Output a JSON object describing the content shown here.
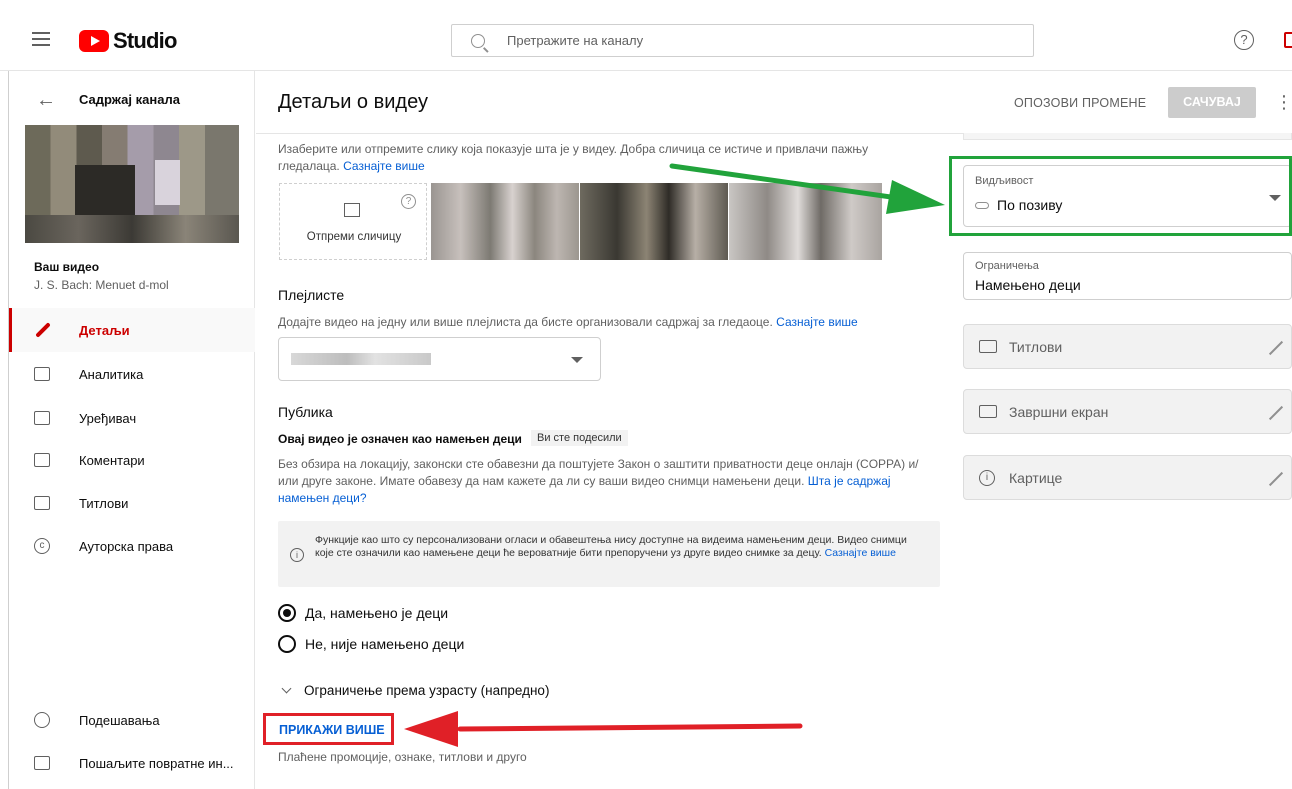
{
  "topbar": {
    "logo_text": "Studio",
    "search_placeholder": "Претражите на каналу"
  },
  "sidebar": {
    "title": "Садржај канала",
    "your_video_label": "Ваш видео",
    "video_title": "J. S. Bach: Menuet d-mol",
    "items": [
      {
        "label": "Детаљи",
        "icon": "pencil-icon",
        "active": true
      },
      {
        "label": "Аналитика",
        "icon": "analytics-icon"
      },
      {
        "label": "Уређивач",
        "icon": "editor-icon"
      },
      {
        "label": "Коментари",
        "icon": "comments-icon"
      },
      {
        "label": "Титлови",
        "icon": "subtitles-icon"
      },
      {
        "label": "Ауторска права",
        "icon": "copyright-icon"
      }
    ],
    "bottom_items": [
      {
        "label": "Подешавања",
        "icon": "gear-icon"
      },
      {
        "label": "Пошаљите повратне ин...",
        "icon": "feedback-icon"
      }
    ]
  },
  "header": {
    "title": "Детаљи о видеу",
    "undo_label": "ОПОЗОВИ ПРОМЕНЕ",
    "save_label": "САЧУВАЈ"
  },
  "thumbnail": {
    "description": "Изаберите или отпремите слику која показује шта је у видеу. Добра сличица се истиче и привлачи пажњу гледалаца.",
    "learn_more": "Сазнајте више",
    "upload_label": "Отпреми сличицу",
    "help_glyph": "?"
  },
  "playlists": {
    "heading": "Плејлисте",
    "description": "Додајте видео на једну или више плејлиста да бисте организовали садржај за гледаоце.",
    "learn_more": "Сазнајте више"
  },
  "audience": {
    "heading": "Публика",
    "subheading": "Овај видео је означен као намењен деци",
    "badge": "Ви сте подесили",
    "coppa_text": "Без обзира на локацију, законски сте обавезни да поштујете Закон о заштити приватности деце онлајн (COPPA) и/или друге законе. Имате обавезу да нам кажете да ли су ваши видео снимци намењени деци.",
    "coppa_link": "Шта је садржај намењен деци?",
    "info_text": "Функције као што су персонализовани огласи и обавештења нису доступне на видеима намењеним деци. Видео снимци које сте означили као намењене деци ће вероватније бити препоручени уз друге видео снимке за децу.",
    "info_link": "Сазнајте више",
    "info_glyph": "i",
    "option_yes": "Да, намењено је деци",
    "option_no": "Не, није намењено деци",
    "age_restriction": "Ограничење према узрасту (напредно)"
  },
  "more": {
    "show_more": "ПРИКАЖИ ВИШЕ",
    "subtitle": "Плаћене промоције, ознаке, титлови и друго"
  },
  "right": {
    "visibility_caption": "Видљивост",
    "visibility_value": "По позиву",
    "restrictions_caption": "Ограничења",
    "restrictions_value": "Намењено деци",
    "subtitles": "Титлови",
    "end_screen": "Завршни екран",
    "cards": "Картице"
  },
  "colors": {
    "accent_red": "#cc0000",
    "link_blue": "#065fd4",
    "annotation_green": "#21a33b",
    "annotation_red": "#e02027"
  }
}
